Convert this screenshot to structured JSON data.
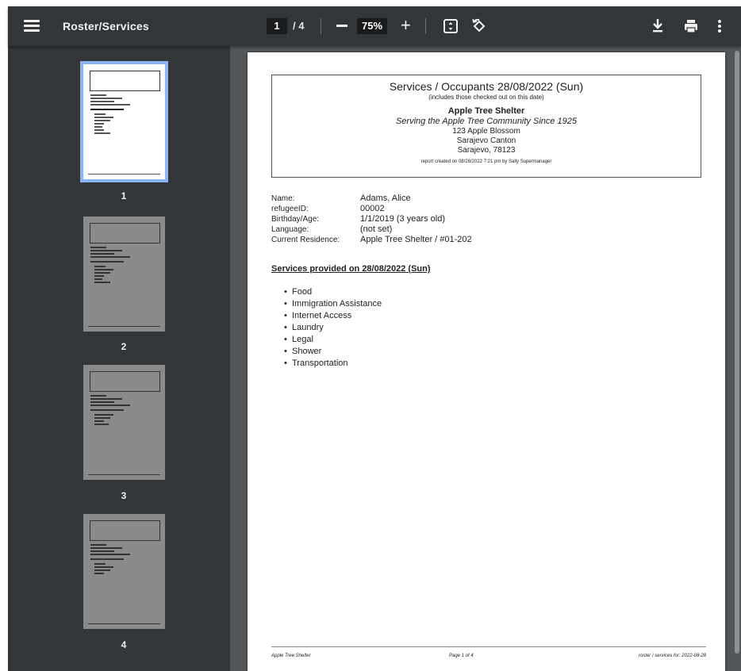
{
  "toolbar": {
    "title": "Roster/Services",
    "current_page": "1",
    "page_total": "/ 4",
    "zoom": "75%",
    "zoom_plus": "+"
  },
  "thumbnails": [
    {
      "label": "1",
      "selected": true
    },
    {
      "label": "2",
      "selected": false
    },
    {
      "label": "3",
      "selected": false
    },
    {
      "label": "4",
      "selected": false
    }
  ],
  "document": {
    "header": {
      "title": "Services / Occupants 28/08/2022 (Sun)",
      "subtitle": "(includes those checked out on this date)",
      "shelter": "Apple Tree Shelter",
      "tagline": "Serving the Apple Tree Community Since 1925",
      "address1": "123 Apple Blossom",
      "address2": "Sarajevo Canton",
      "address3": "Sarajevo, 78123",
      "created": "report created on 08/28/2022 7:21 pm by Sally Supermanager"
    },
    "fields": [
      {
        "label": "Name:",
        "value": "Adams, Alice"
      },
      {
        "label": "refugeeID:",
        "value": "00002"
      },
      {
        "label": "Birthday/Age:",
        "value": "1/1/2019 (3 years old)"
      },
      {
        "label": "Language:",
        "value": "(not set)"
      },
      {
        "label": "Current Residence:",
        "value": "Apple Tree Shelter / #01-202"
      }
    ],
    "services_heading": "Services provided on 28/08/2022 (Sun)",
    "services": [
      "Food",
      "Immigration Assistance",
      "Internet Access",
      "Laundry",
      "Legal",
      "Shower",
      "Transportation"
    ],
    "footer": {
      "left": "Apple Tree Shelter",
      "center": "Page 1 of 4",
      "right": "roster / services for: 2022-08-28"
    }
  },
  "colors": {
    "toolbar_bg": "#323639",
    "viewer_bg": "#525659",
    "selected_thumb": "#8ab4f8"
  }
}
